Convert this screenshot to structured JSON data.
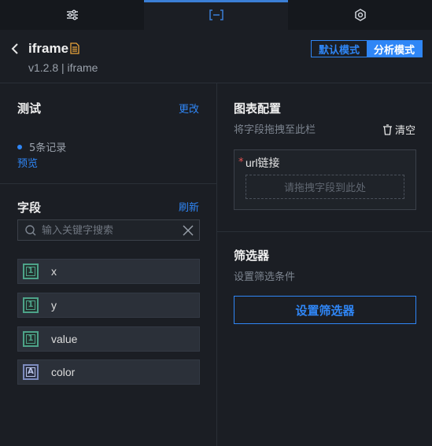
{
  "tabs": [
    {
      "icon": "sliders-icon",
      "glyph": "☰",
      "active": false
    },
    {
      "icon": "bracket-icon",
      "glyph": "[–]",
      "active": true
    },
    {
      "icon": "cube-icon",
      "glyph": "⬡",
      "active": false
    }
  ],
  "header": {
    "title": "iframe",
    "version": "v1.2.8 | iframe",
    "mode_default": "默认模式",
    "mode_analysis": "分析模式"
  },
  "test": {
    "title": "测试",
    "edit": "更改",
    "records": "5条记录",
    "preview": "预览"
  },
  "fields": {
    "title": "字段",
    "refresh": "刷新",
    "search_placeholder": "输入关键字搜索",
    "items": [
      {
        "name": "x",
        "type": "1"
      },
      {
        "name": "y",
        "type": "1"
      },
      {
        "name": "value",
        "type": "1"
      },
      {
        "name": "color",
        "type": "A"
      }
    ]
  },
  "chart_config": {
    "title": "图表配置",
    "hint": "将字段拖拽至此栏",
    "clear": "清空",
    "url_label": "url链接",
    "required_mark": "*",
    "drop_hint": "请拖拽字段到此处"
  },
  "filter": {
    "title": "筛选器",
    "hint": "设置筛选条件",
    "button": "设置筛选器"
  },
  "colors": {
    "accent": "#2f86f6",
    "background": "#1b1e24",
    "number_type": "#4da389",
    "string_type": "#7c8bbd"
  }
}
